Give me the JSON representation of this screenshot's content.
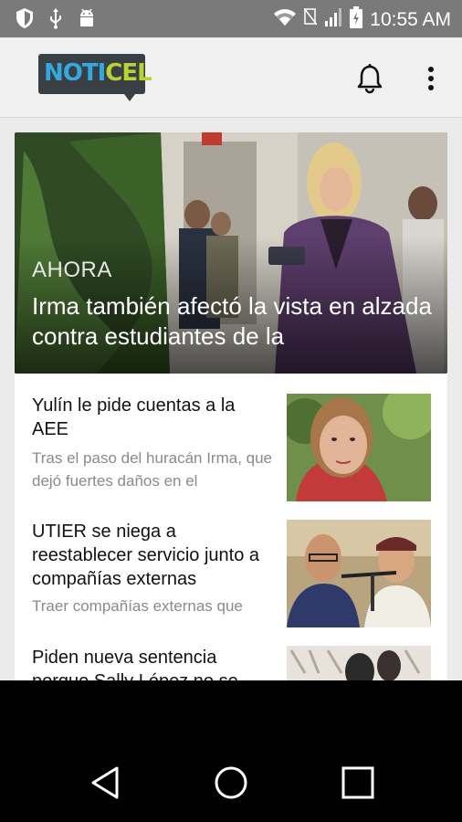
{
  "status_bar": {
    "time": "10:55 AM",
    "left_icons": [
      "shield-icon",
      "usb-icon",
      "android-icon"
    ],
    "right_icons": [
      "wifi-icon",
      "no-sim-icon",
      "signal-icon",
      "battery-icon"
    ]
  },
  "app_bar": {
    "logo_part1": "NOTI",
    "logo_part2": "CEL",
    "actions": [
      "bell-icon",
      "more-vert-icon"
    ]
  },
  "hero": {
    "kicker": "AHORA",
    "headline": "Irma también afectó la vista en alzada contra estudiantes de la"
  },
  "articles": [
    {
      "title": "Yulín le pide cuentas a la AEE",
      "summary": "Tras el paso del huracán Irma, que dejó fuertes daños en el"
    },
    {
      "title": "UTIER se niega a reestablecer servicio junto a compañías externas",
      "summary": "Traer compañías externas que"
    },
    {
      "title": "Piden nueva sentencia porque Sally López no se",
      "summary": ""
    }
  ],
  "nav_bar": {
    "buttons": [
      "back-icon",
      "home-icon",
      "recents-icon"
    ]
  },
  "colors": {
    "status_bar": "#7a7a7a",
    "app_bar": "#f0f0f0",
    "logo_blue": "#33a9e0",
    "logo_green": "#b8d432",
    "logo_bg": "#3a3f44"
  }
}
